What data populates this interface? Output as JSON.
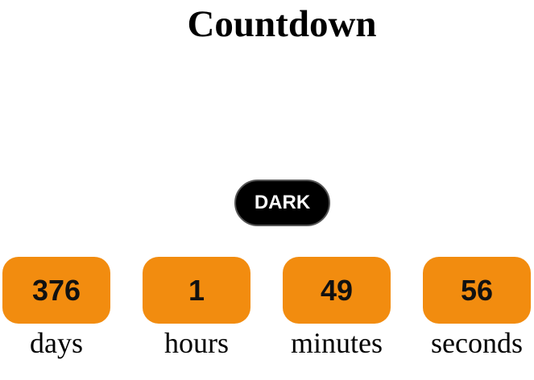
{
  "title": "Countdown",
  "theme_toggle": {
    "label": "DARK"
  },
  "countdown": {
    "days": {
      "value": "376",
      "label": "days"
    },
    "hours": {
      "value": "1",
      "label": "hours"
    },
    "minutes": {
      "value": "49",
      "label": "minutes"
    },
    "seconds": {
      "value": "56",
      "label": "seconds"
    }
  },
  "colors": {
    "box_background": "#f28c0f",
    "toggle_background": "#000000",
    "toggle_text": "#ffffff",
    "page_background": "#ffffff"
  }
}
